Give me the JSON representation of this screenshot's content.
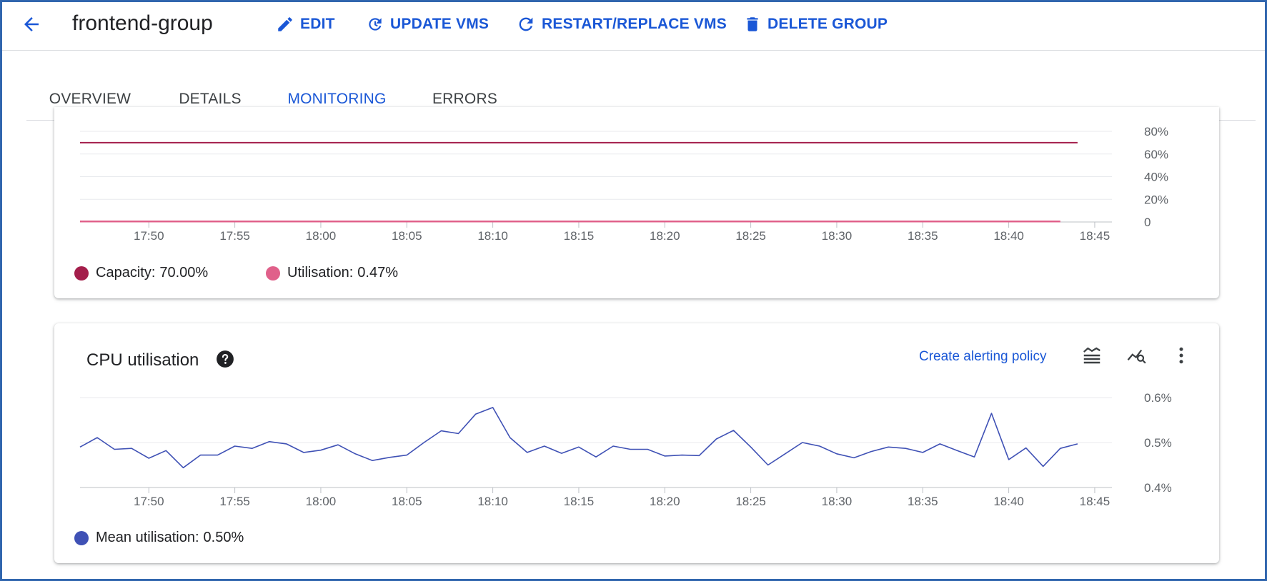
{
  "header": {
    "title": "frontend-group",
    "actions": {
      "edit": "EDIT",
      "update": "UPDATE VMS",
      "restart": "RESTART/REPLACE VMS",
      "delete": "DELETE GROUP"
    }
  },
  "tabs": [
    "OVERVIEW",
    "DETAILS",
    "MONITORING",
    "ERRORS"
  ],
  "active_tab": "MONITORING",
  "colors": {
    "accent": "#1a57d6",
    "capacity": "#a41e4b",
    "utilisation": "#e0608a",
    "cpu": "#3f51b5"
  },
  "capacity_card": {
    "legend": {
      "capacity_label": "Capacity:",
      "capacity_value": "70.00%",
      "utilisation_label": "Utilisation:",
      "utilisation_value": "0.47%"
    }
  },
  "cpu_card": {
    "title": "CPU utilisation",
    "alert_link": "Create alerting policy",
    "legend": {
      "mean_label": "Mean utilisation:",
      "mean_value": "0.50%"
    }
  },
  "chart_data": [
    {
      "type": "line",
      "x_ticks": [
        "17:50",
        "17:55",
        "18:00",
        "18:05",
        "18:10",
        "18:15",
        "18:20",
        "18:25",
        "18:30",
        "18:35",
        "18:40",
        "18:45"
      ],
      "y_ticks": [
        "0",
        "20%",
        "40%",
        "60%",
        "80%"
      ],
      "ylim": [
        0,
        80
      ],
      "x_range": [
        "17:46",
        "18:46"
      ],
      "grid": true,
      "series": [
        {
          "name": "Capacity",
          "x": [
            "17:46",
            "18:44"
          ],
          "values": [
            70,
            70
          ]
        },
        {
          "name": "Utilisation",
          "x": [
            "17:46",
            "18:43"
          ],
          "values": [
            0.47,
            0.47
          ]
        }
      ]
    },
    {
      "type": "line",
      "x_ticks": [
        "17:50",
        "17:55",
        "18:00",
        "18:05",
        "18:10",
        "18:15",
        "18:20",
        "18:25",
        "18:30",
        "18:35",
        "18:40",
        "18:45"
      ],
      "y_ticks": [
        "0.4%",
        "0.5%",
        "0.6%"
      ],
      "ylim": [
        0.4,
        0.6
      ],
      "x_range": [
        "17:46",
        "18:46"
      ],
      "grid": true,
      "series": [
        {
          "name": "Mean utilisation",
          "x": [
            "17:46",
            "17:47",
            "17:48",
            "17:49",
            "17:50",
            "17:51",
            "17:52",
            "17:53",
            "17:54",
            "17:55",
            "17:56",
            "17:57",
            "17:58",
            "17:59",
            "18:00",
            "18:01",
            "18:02",
            "18:03",
            "18:04",
            "18:05",
            "18:06",
            "18:07",
            "18:08",
            "18:09",
            "18:10",
            "18:11",
            "18:12",
            "18:13",
            "18:14",
            "18:15",
            "18:16",
            "18:17",
            "18:18",
            "18:19",
            "18:20",
            "18:21",
            "18:22",
            "18:23",
            "18:24",
            "18:25",
            "18:26",
            "18:27",
            "18:28",
            "18:29",
            "18:30",
            "18:31",
            "18:32",
            "18:33",
            "18:34",
            "18:35",
            "18:36",
            "18:37",
            "18:38",
            "18:39",
            "18:40",
            "18:41",
            "18:42",
            "18:43",
            "18:44"
          ],
          "values": [
            0.49,
            0.511,
            0.485,
            0.487,
            0.465,
            0.482,
            0.444,
            0.472,
            0.472,
            0.492,
            0.487,
            0.502,
            0.497,
            0.478,
            0.483,
            0.495,
            0.475,
            0.46,
            0.467,
            0.472,
            0.5,
            0.526,
            0.52,
            0.563,
            0.578,
            0.511,
            0.478,
            0.492,
            0.476,
            0.49,
            0.468,
            0.492,
            0.485,
            0.485,
            0.47,
            0.472,
            0.471,
            0.508,
            0.527,
            0.49,
            0.45,
            0.475,
            0.5,
            0.492,
            0.475,
            0.466,
            0.48,
            0.49,
            0.487,
            0.478,
            0.497,
            0.482,
            0.468,
            0.565,
            0.462,
            0.488,
            0.447,
            0.487,
            0.497
          ]
        }
      ]
    }
  ]
}
